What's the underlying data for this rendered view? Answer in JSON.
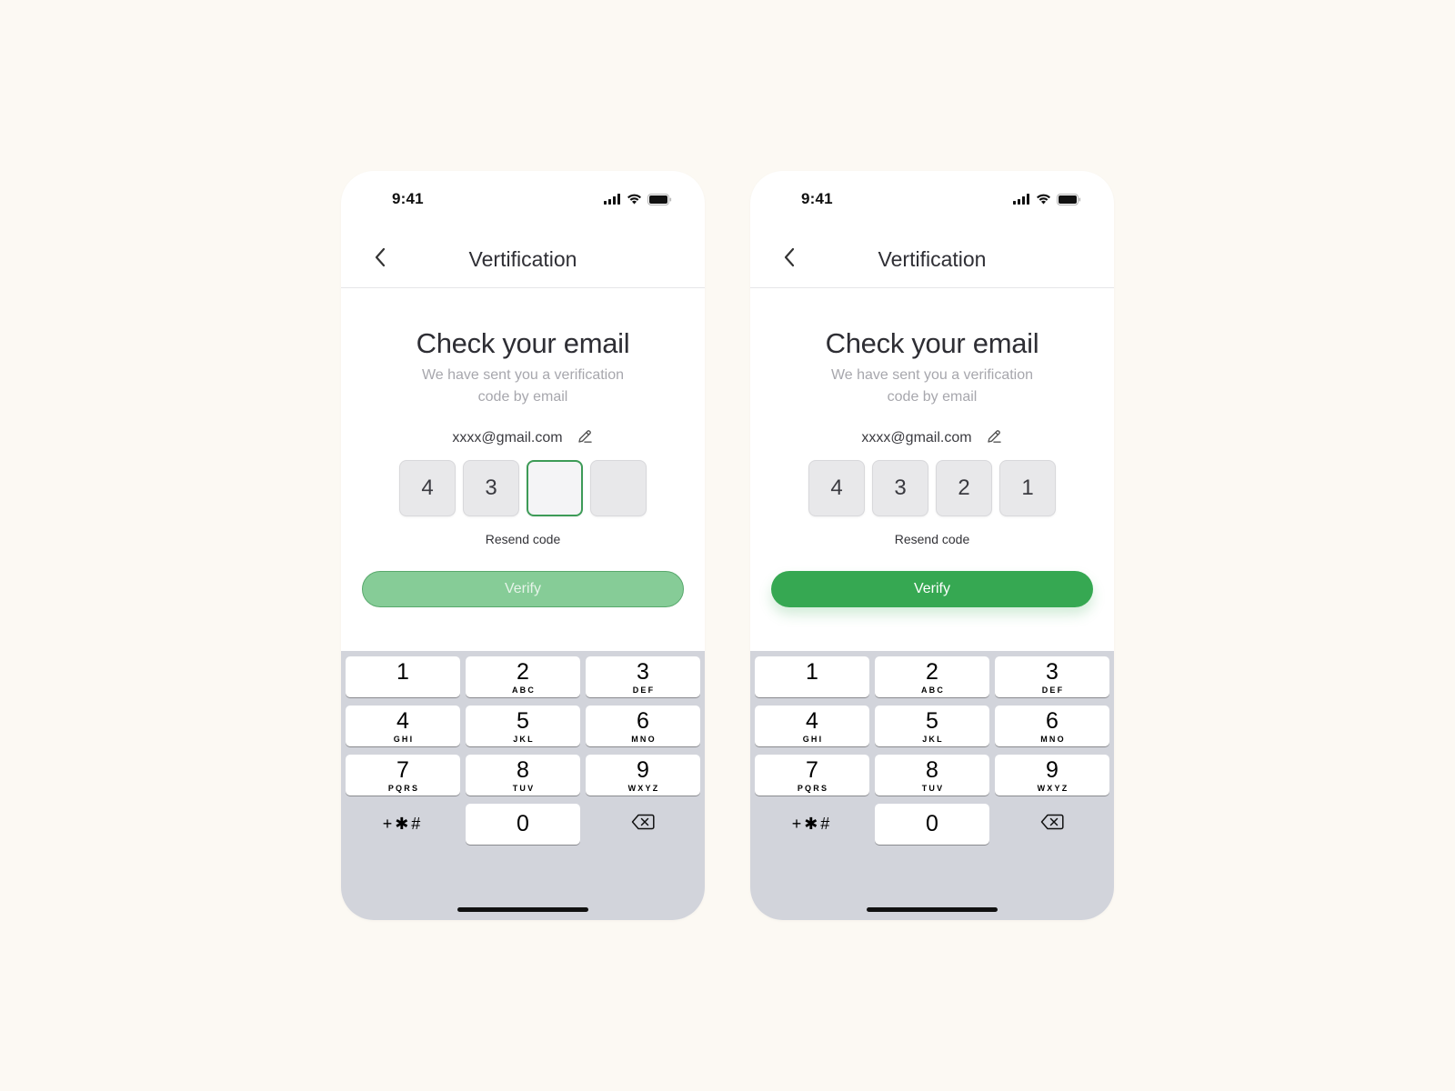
{
  "screens": [
    {
      "status": {
        "time": "9:41"
      },
      "nav": {
        "title": "Vertification"
      },
      "heading": "Check your email",
      "subtitle": "We have sent you a verification code by email",
      "email": "xxxx@gmail.com",
      "code": [
        "4",
        "3",
        "",
        ""
      ],
      "active_index": 2,
      "resend_label": "Resend code",
      "verify_label": "Verify",
      "verify_state": "disabled"
    },
    {
      "status": {
        "time": "9:41"
      },
      "nav": {
        "title": "Vertification"
      },
      "heading": "Check your email",
      "subtitle": "We have sent you a verification code by email",
      "email": "xxxx@gmail.com",
      "code": [
        "4",
        "3",
        "2",
        "1"
      ],
      "active_index": -1,
      "resend_label": "Resend code",
      "verify_label": "Verify",
      "verify_state": "enabled"
    }
  ],
  "keypad": {
    "keys": [
      {
        "num": "1",
        "letters": ""
      },
      {
        "num": "2",
        "letters": "ABC"
      },
      {
        "num": "3",
        "letters": "DEF"
      },
      {
        "num": "4",
        "letters": "GHI"
      },
      {
        "num": "5",
        "letters": "JKL"
      },
      {
        "num": "6",
        "letters": "MNO"
      },
      {
        "num": "7",
        "letters": "PQRS"
      },
      {
        "num": "8",
        "letters": "TUV"
      },
      {
        "num": "9",
        "letters": "WXYZ"
      }
    ],
    "symbols_label": "+✱#",
    "zero": "0",
    "delete_icon": "backspace-icon"
  },
  "colors": {
    "accent": "#36a852",
    "accent_disabled": "#86cc97",
    "active_border": "#3d9b57",
    "keyboard_bg": "#d2d4db",
    "page_bg": "#fcf9f3"
  }
}
